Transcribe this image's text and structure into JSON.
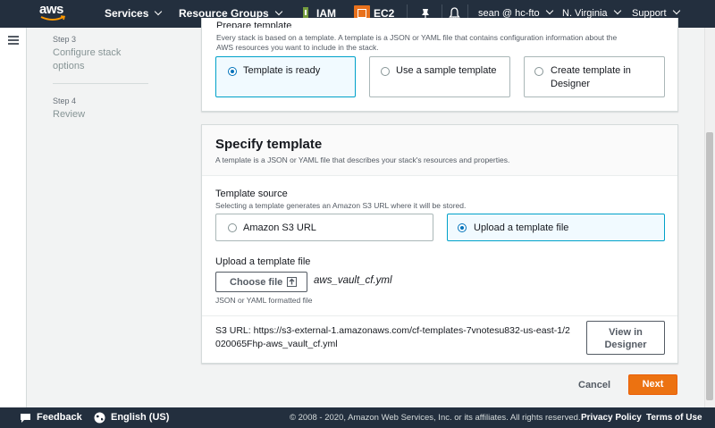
{
  "topnav": {
    "logo": "aws",
    "services": "Services",
    "resource_groups": "Resource Groups",
    "iam": "IAM",
    "ec2": "EC2",
    "account": "sean @ hc-fto",
    "region": "N. Virginia",
    "support": "Support",
    "pin_icon": "pushpin-icon",
    "bell_icon": "bell-icon"
  },
  "steps": {
    "step3_label": "Step 3",
    "step3_title_line1": "Configure stack",
    "step3_title_line2": "options",
    "step4_label": "Step 4",
    "step4_title": "Review"
  },
  "prepare": {
    "title": "Prepare template",
    "description_line1": "Every stack is based on a template. A template is a JSON or YAML file that contains configuration information about the",
    "description_line2": "AWS resources you want to include in the stack.",
    "options": [
      {
        "label": "Template is ready",
        "selected": true
      },
      {
        "label": "Use a sample template",
        "selected": false
      },
      {
        "label_line1": "Create template in",
        "label_line2": "Designer",
        "selected": false
      }
    ]
  },
  "specify": {
    "title": "Specify template",
    "description": "A template is a JSON or YAML file that describes your stack's resources and properties.",
    "source_label": "Template source",
    "source_hint": "Selecting a template generates an Amazon S3 URL where it will be stored.",
    "source_options": [
      {
        "label": "Amazon S3 URL",
        "selected": false
      },
      {
        "label": "Upload a template file",
        "selected": true
      }
    ],
    "upload_label": "Upload a template file",
    "choose_file": "Choose file",
    "file_name": "aws_vault_cf.yml",
    "file_hint": "JSON or YAML formatted file",
    "s3_url_line1": "S3 URL:  https://s3-external-1.amazonaws.com/cf-templates-7vnotesu832-us-east-1/2",
    "s3_url_line2": "020065Fhp-aws_vault_cf.yml",
    "view_designer_line1": "View in",
    "view_designer_line2": "Designer"
  },
  "actions": {
    "cancel": "Cancel",
    "next": "Next"
  },
  "footer": {
    "feedback": "Feedback",
    "language": "English (US)",
    "copyright": "© 2008 - 2020, Amazon Web Services, Inc. or its affiliates. All rights reserved.",
    "privacy": "Privacy Policy",
    "terms": "Terms of Use"
  },
  "colors": {
    "nav_bg": "#232f3e",
    "accent_orange": "#ec7211",
    "selected_border": "#00a1c9",
    "radio_blue": "#0073bb"
  }
}
